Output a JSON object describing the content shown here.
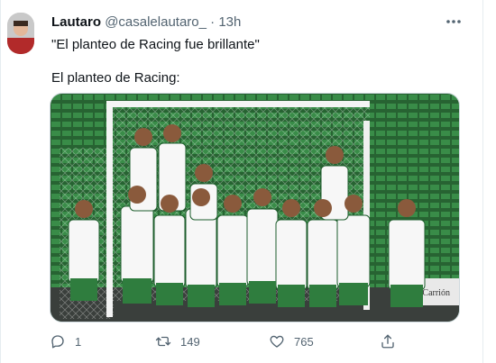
{
  "tweet": {
    "author_name": "Lautaro",
    "handle": "@casalelautaro_",
    "separator": "·",
    "time": "13h",
    "text_line1": "\"El planteo de Racing fue brillante\"",
    "text_line2": "El planteo de Racing:"
  },
  "photo": {
    "banner_text": "El Carrión"
  },
  "actions": {
    "reply_count": "1",
    "retweet_count": "149",
    "like_count": "765"
  },
  "icons": {
    "more": "more-horizontal-icon",
    "reply": "reply-icon",
    "retweet": "retweet-icon",
    "like": "heart-icon",
    "share": "share-icon"
  },
  "colors": {
    "text_primary": "#0f1419",
    "text_secondary": "#536471",
    "stadium_green": "#2f7d3e"
  }
}
